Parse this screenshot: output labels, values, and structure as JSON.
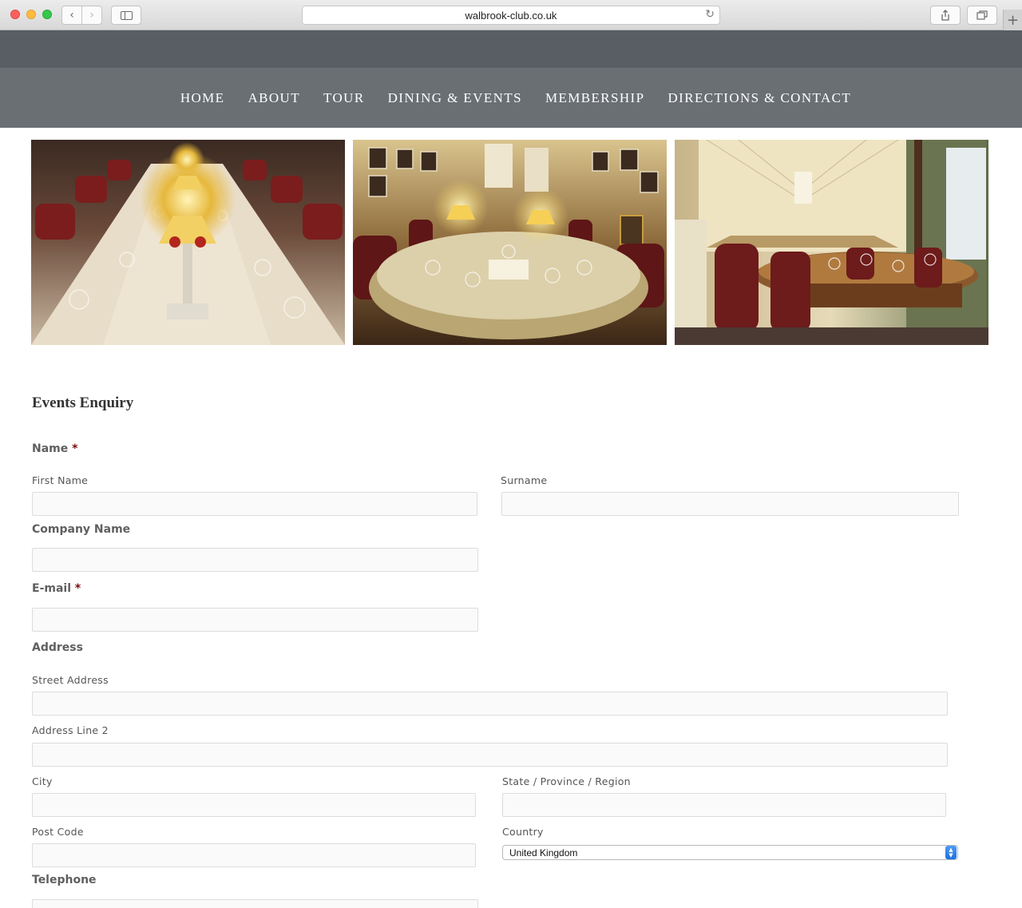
{
  "browser": {
    "url": "walbrook-club.co.uk"
  },
  "nav": {
    "items": [
      {
        "label": "HOME"
      },
      {
        "label": "ABOUT"
      },
      {
        "label": "TOUR"
      },
      {
        "label": "DINING & EVENTS"
      },
      {
        "label": "MEMBERSHIP"
      },
      {
        "label": "DIRECTIONS & CONTACT"
      }
    ]
  },
  "form": {
    "title": "Events Enquiry",
    "required_mark": "*",
    "name": {
      "label": "Name",
      "first_label": "First Name",
      "first_value": "",
      "surname_label": "Surname",
      "surname_value": ""
    },
    "company": {
      "label": "Company Name",
      "value": ""
    },
    "email": {
      "label": "E-mail",
      "value": ""
    },
    "address": {
      "label": "Address",
      "street_label": "Street Address",
      "street_value": "",
      "line2_label": "Address Line 2",
      "line2_value": "",
      "city_label": "City",
      "city_value": "",
      "state_label": "State / Province / Region",
      "state_value": "",
      "postcode_label": "Post Code",
      "postcode_value": "",
      "country_label": "Country",
      "country_value": "United Kingdom"
    },
    "telephone": {
      "label": "Telephone",
      "value": ""
    }
  },
  "icons": {
    "back": "chevron-left-icon",
    "forward": "chevron-right-icon",
    "sidebar": "sidebar-icon",
    "reload": "reload-icon",
    "share": "share-icon",
    "tabs": "tabs-icon",
    "new_tab": "plus-icon",
    "select_arrows": "up-down-arrows-icon"
  }
}
